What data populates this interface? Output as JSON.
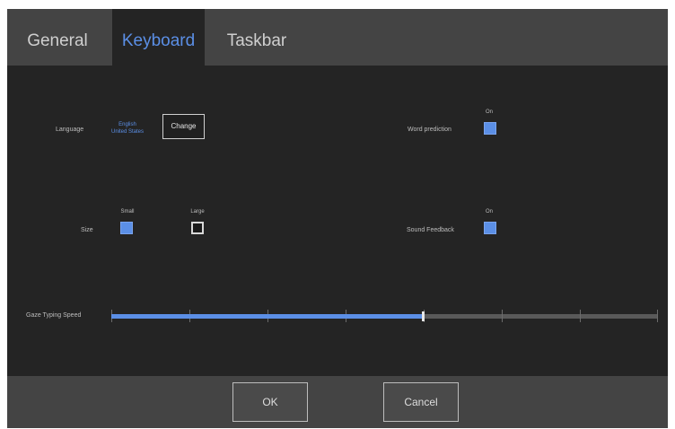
{
  "tabs": [
    {
      "label": "General",
      "active": false
    },
    {
      "label": "Keyboard",
      "active": true
    },
    {
      "label": "Taskbar",
      "active": false
    }
  ],
  "settings": {
    "language_label": "Language",
    "language_value_line1": "English",
    "language_value_line2": "United States",
    "change_label": "Change",
    "word_prediction_label": "Word prediction",
    "word_prediction_on_label": "On",
    "word_prediction_checked": true,
    "size_label": "Size",
    "size_small_label": "Small",
    "size_large_label": "Large",
    "size_selected": "Small",
    "sound_feedback_label": "Sound Feedback",
    "sound_feedback_on_label": "On",
    "sound_feedback_checked": true,
    "gaze_speed_label": "Gaze Typing Speed",
    "gaze_speed_value": 0.57
  },
  "footer": {
    "ok_label": "OK",
    "cancel_label": "Cancel"
  },
  "colors": {
    "accent": "#5b8fe6",
    "panel": "#242424",
    "bar": "#444444"
  }
}
